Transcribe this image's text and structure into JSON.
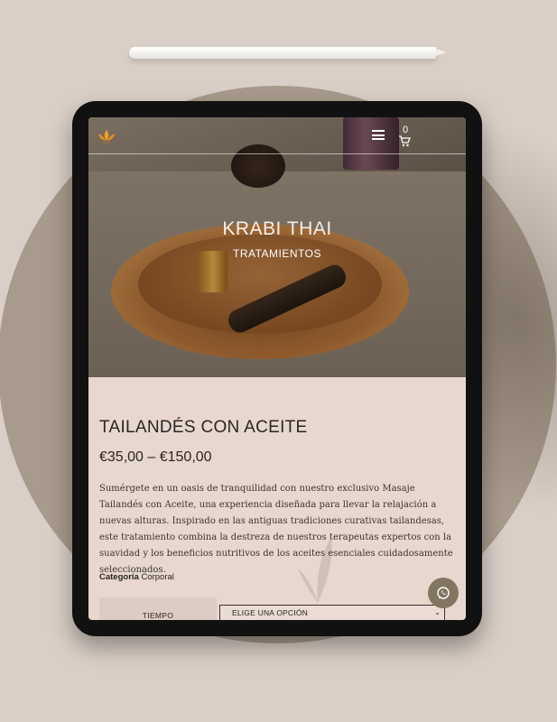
{
  "header": {
    "cart_count": "0",
    "icons": [
      "lotus-logo-icon",
      "hamburger-menu-icon",
      "cart-icon",
      "whatsapp-icon"
    ]
  },
  "hero": {
    "title": "KRABI THAI",
    "subtitle": "TRATAMIENTOS"
  },
  "product": {
    "title": "TAILANDÉS CON ACEITE",
    "price": "€35,00 – €150,00",
    "description": "Sumérgete en un oasis de tranquilidad con nuestro exclusivo Masaje Tailandés con Aceite, una experiencia diseñada para llevar la relajación a nuevas alturas. Inspirado en las antiguas tradiciones curativas tailandesas, este tratamiento combina la destreza de nuestros terapeutas expertos con la suavidad y los beneficios nutritivos de los aceites esenciales cuidadosamente seleccionados.",
    "category_label": "Categoría",
    "category_value": "Corporal"
  },
  "variation": {
    "label": "TIEMPO",
    "select_value": "ELIGE UNA OPCIÓN"
  },
  "colors": {
    "background": "#d9cfc6",
    "content_bg": "#e7d7cf",
    "whatsapp_button": "#837660",
    "logo_orange": "#e8901c"
  }
}
